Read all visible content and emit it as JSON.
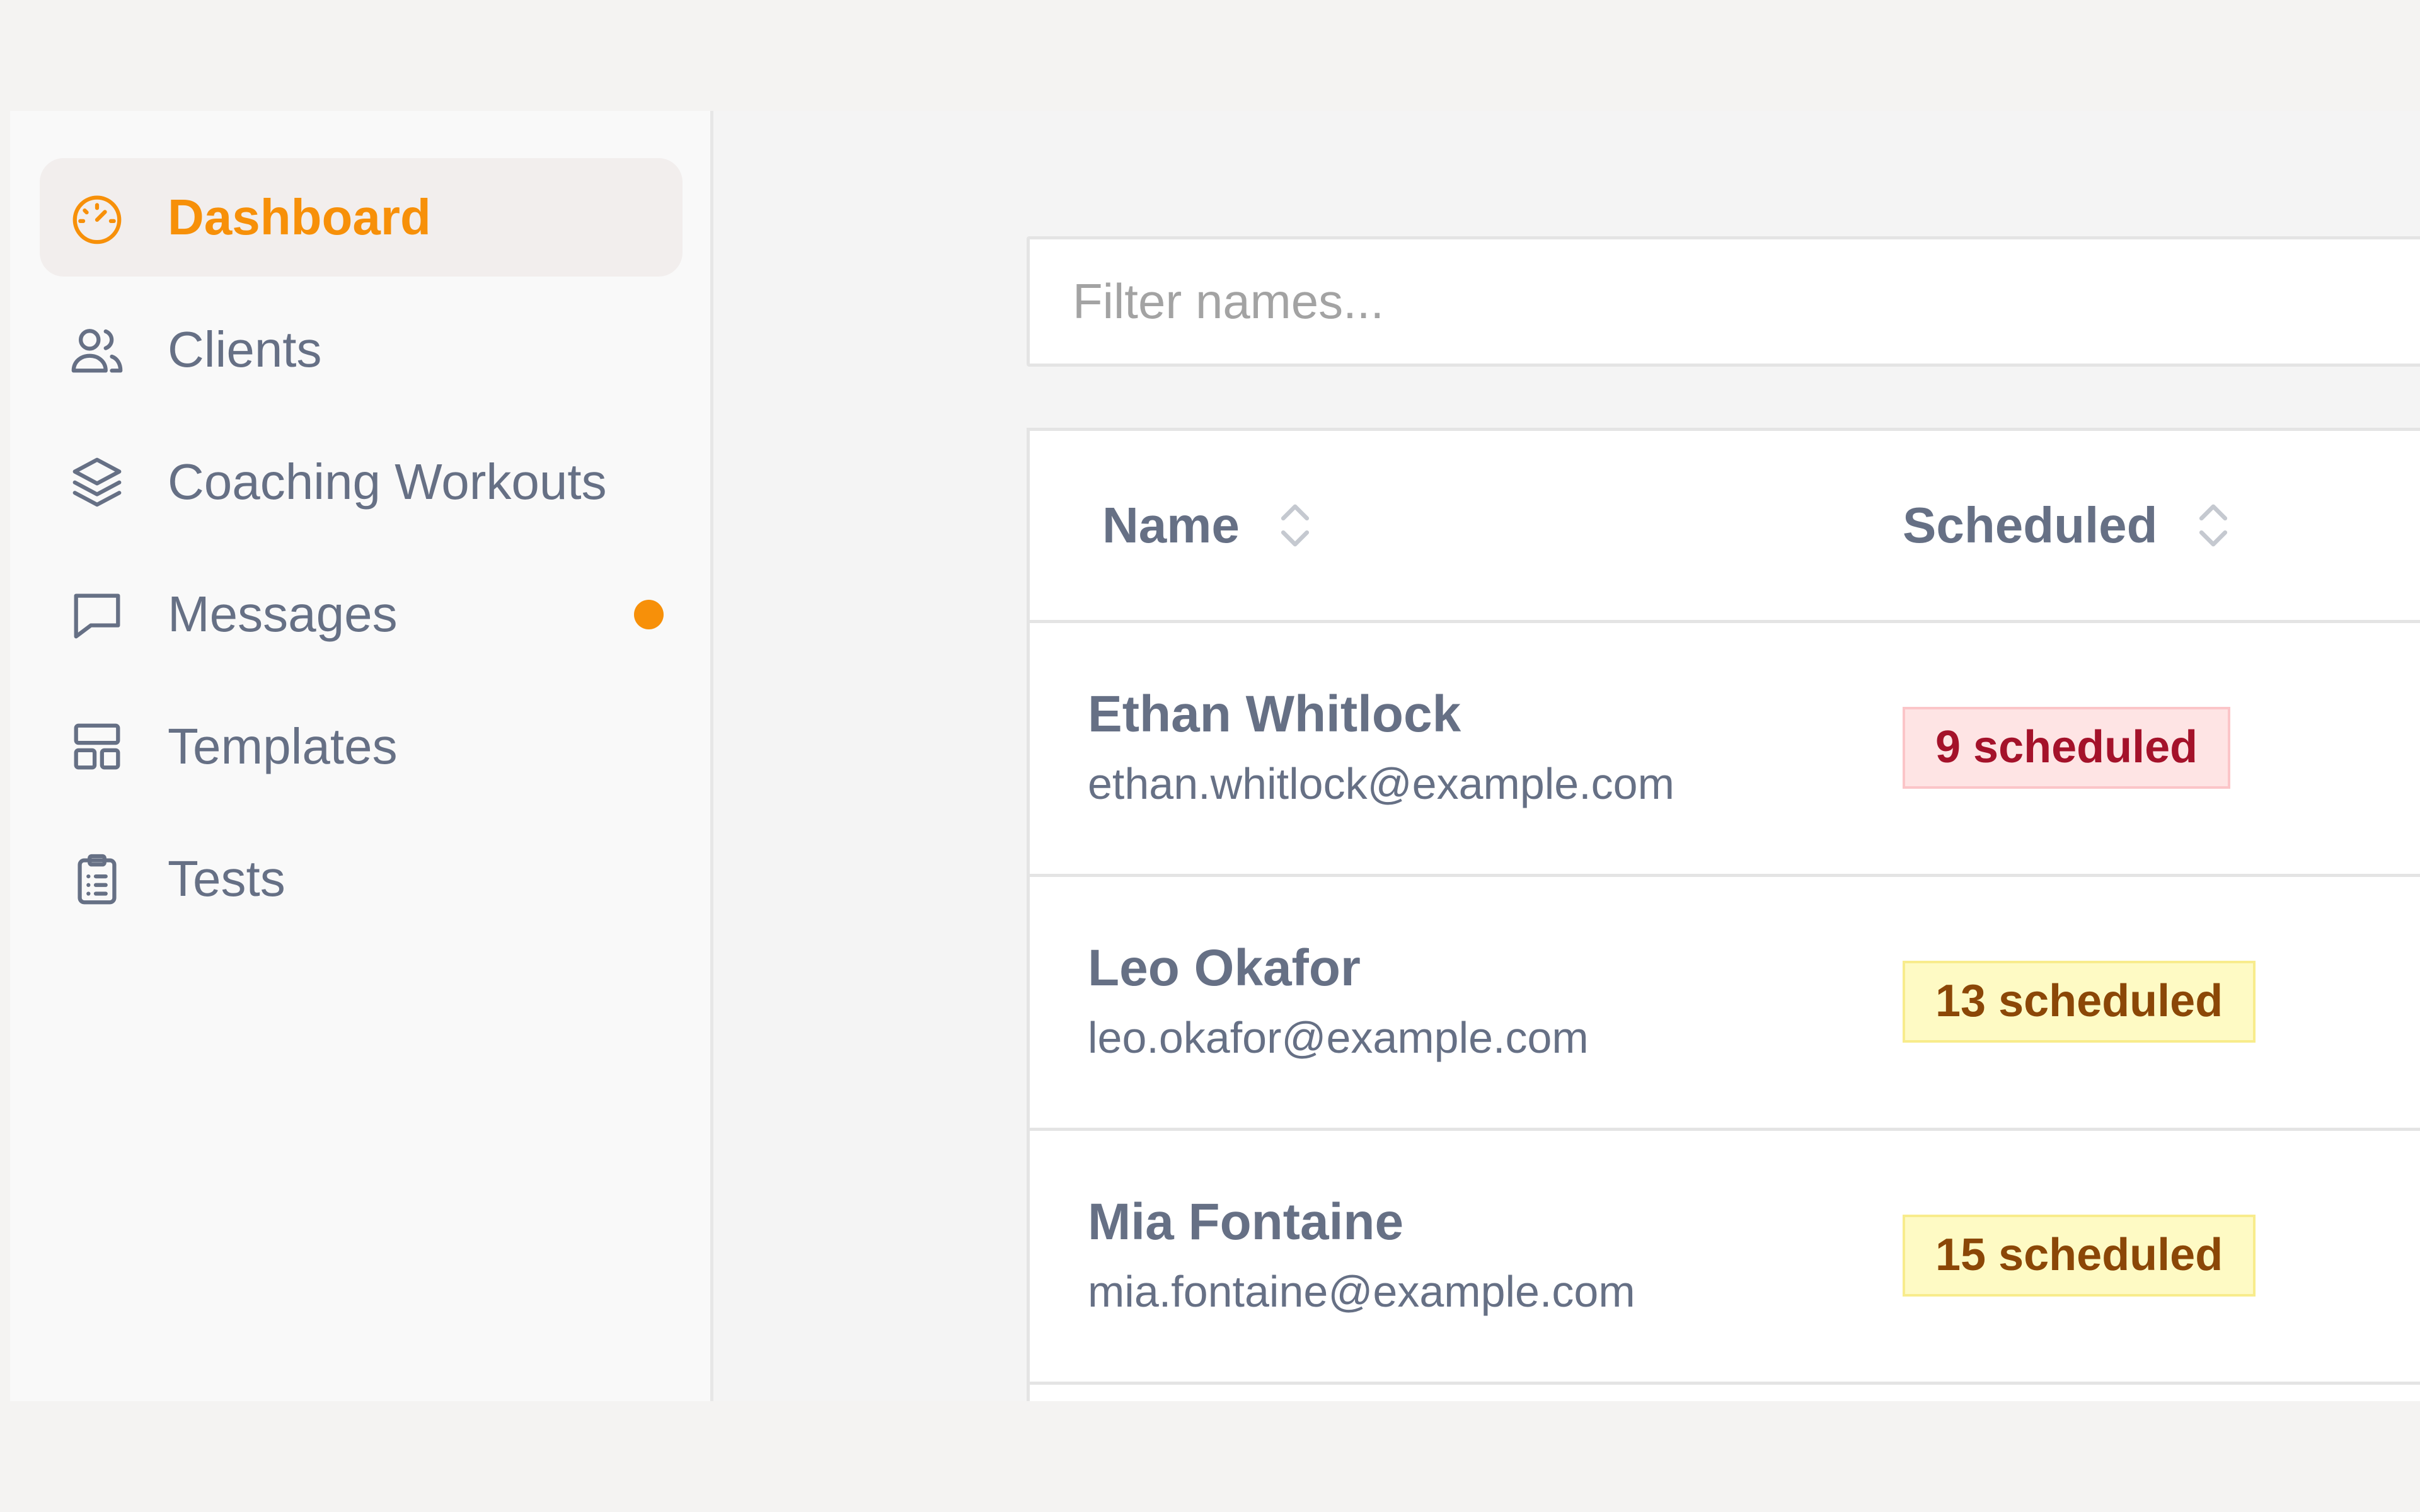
{
  "sidebar": {
    "items": [
      {
        "label": "Dashboard",
        "icon": "gauge-icon",
        "active": true
      },
      {
        "label": "Clients",
        "icon": "users-icon",
        "active": false
      },
      {
        "label": "Coaching Workouts",
        "icon": "layers-icon",
        "active": false
      },
      {
        "label": "Messages",
        "icon": "message-square-icon",
        "active": false,
        "has_notification": true
      },
      {
        "label": "Templates",
        "icon": "layout-template-icon",
        "active": false
      },
      {
        "label": "Tests",
        "icon": "clipboard-list-icon",
        "active": false
      }
    ]
  },
  "filter": {
    "placeholder": "Filter names...",
    "value": ""
  },
  "table": {
    "columns": [
      {
        "label": "Name",
        "sortable": true
      },
      {
        "label": "Scheduled",
        "sortable": true
      }
    ],
    "rows": [
      {
        "name": "Ethan Whitlock",
        "email": "ethan.whitlock@example.com",
        "scheduled": "9 scheduled",
        "scheduled_status": "red"
      },
      {
        "name": "Leo Okafor",
        "email": "leo.okafor@example.com",
        "scheduled": "13 scheduled",
        "scheduled_status": "yellow"
      },
      {
        "name": "Mia Fontaine",
        "email": "mia.fontaine@example.com",
        "scheduled": "15 scheduled",
        "scheduled_status": "yellow"
      }
    ]
  },
  "colors": {
    "accent": "#f79009",
    "text_muted": "#667085",
    "tag_red_bg": "#fee4e4",
    "tag_red_text": "#a4122a",
    "tag_yellow_bg": "#fefac4",
    "tag_yellow_text": "#8b4707"
  }
}
